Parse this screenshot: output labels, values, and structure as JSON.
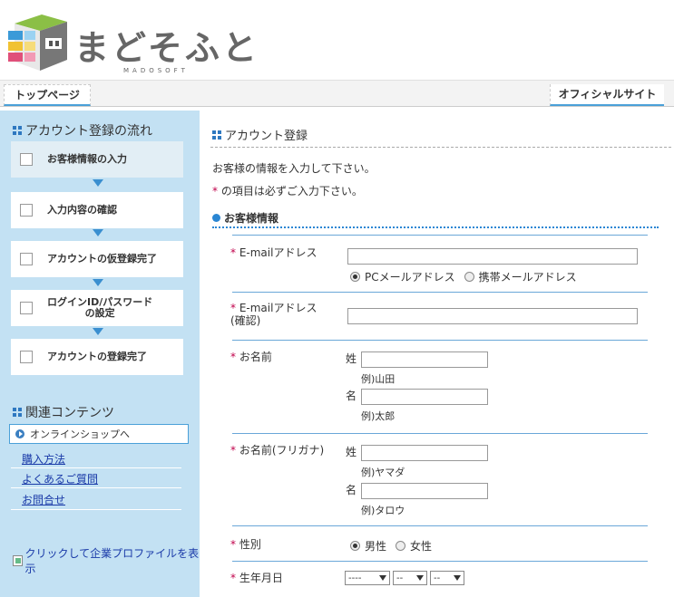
{
  "header": {
    "logo_text": "まどそふと",
    "logo_sub": "MADOSOFT"
  },
  "topnav": {
    "top_label": "トップページ",
    "official_label": "オフィシャルサイト"
  },
  "sidebar": {
    "flow_heading": "アカウント登録の流れ",
    "steps": [
      {
        "label": "お客様情報の入力"
      },
      {
        "label": "入力内容の確認"
      },
      {
        "label": "アカウントの仮登録完了"
      },
      {
        "label": "ログインID/パスワード\nの設定"
      },
      {
        "label": "アカウントの登録完了"
      }
    ],
    "related_heading": "関連コンテンツ",
    "shop_label": "オンラインショップへ",
    "links": [
      "購入方法",
      "よくあるご質問",
      "お問合せ"
    ],
    "banner_alt": "クリックして企業プロファイルを表示"
  },
  "main": {
    "title": "アカウント登録",
    "intro": "お客様の情報を入力して下さい。",
    "required_mark": "*",
    "required_note": "の項目は必ずご入力下さい。",
    "section_title": "お客様情報",
    "email": {
      "label": "E-mailアドレス",
      "value": "",
      "radio_pc": "PCメールアドレス",
      "radio_mobile": "携帯メールアドレス"
    },
    "email_confirm": {
      "label": "E-mailアドレス(確認)",
      "value": ""
    },
    "name": {
      "label": "お名前",
      "last_label": "姓",
      "last_example": "例)山田",
      "first_label": "名",
      "first_example": "例)太郎"
    },
    "kana": {
      "label": "お名前(フリガナ)",
      "last_label": "姓",
      "last_example": "例)ヤマダ",
      "first_label": "名",
      "first_example": "例)タロウ"
    },
    "gender": {
      "label": "性別",
      "male": "男性",
      "female": "女性"
    },
    "birthday": {
      "label": "生年月日",
      "year": "----",
      "month": "--",
      "day": "--"
    }
  }
}
